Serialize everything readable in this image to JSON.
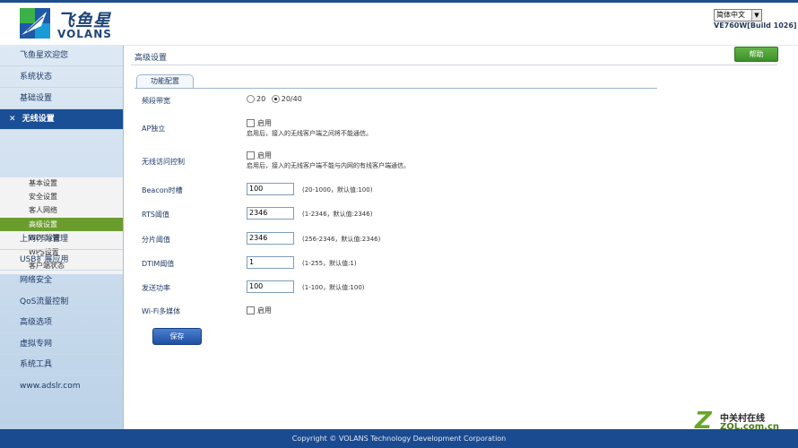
{
  "brand": {
    "name_cn": "飞鱼星",
    "name_en": "VOLANS"
  },
  "header": {
    "language": "简体中文",
    "build": "VE760W[Build 1026]"
  },
  "sidebar": {
    "items": [
      {
        "label": "飞鱼星欢迎您"
      },
      {
        "label": "系统状态"
      },
      {
        "label": "基础设置"
      },
      {
        "label": "无线设置"
      },
      {
        "label": "上网行为管理"
      },
      {
        "label": "USB扩展应用"
      },
      {
        "label": "网络安全"
      },
      {
        "label": "QoS流量控制"
      },
      {
        "label": "高级选项"
      },
      {
        "label": "虚拟专网"
      },
      {
        "label": "系统工具"
      },
      {
        "label": "www.adslr.com"
      }
    ],
    "submenu": [
      {
        "label": "基本设置"
      },
      {
        "label": "安全设置"
      },
      {
        "label": "客人网络"
      },
      {
        "label": "高级设置"
      },
      {
        "label": "WDS设置"
      },
      {
        "label": "WPS设置"
      },
      {
        "label": "客户端状态"
      }
    ],
    "expanded_marker": "✕"
  },
  "main": {
    "help": "帮助",
    "title": "高级设置",
    "tab": "功能配置",
    "bandwidth": {
      "label": "频段带宽",
      "options": [
        "20",
        "20/40"
      ],
      "selected": "20/40"
    },
    "ap_isolation": {
      "label": "AP独立",
      "checkbox": "启用",
      "note": "启用后，接入的无线客户端之间将不能通信。"
    },
    "wireless_access": {
      "label": "无线访问控制",
      "checkbox": "启用",
      "note": "启用后，接入的无线客户端不能与内网的有线客户端通信。"
    },
    "beacon": {
      "label": "Beacon时槽",
      "value": "100",
      "range": "(20-1000，默认值:100)"
    },
    "rts": {
      "label": "RTS阈值",
      "value": "2346",
      "range": "(1-2346，默认值:2346)"
    },
    "frag": {
      "label": "分片阈值",
      "value": "2346",
      "range": "(256-2346，默认值:2346)"
    },
    "dtim": {
      "label": "DTIM阈值",
      "value": "1",
      "range": "(1-255，默认值:1)"
    },
    "power": {
      "label": "发送功率",
      "value": "100",
      "range": "(1-100，默认值:100)"
    },
    "wmm": {
      "label": "Wi-Fi多媒体",
      "checkbox": "启用"
    },
    "save": "保存"
  },
  "footer": {
    "copyright": "Copyright © VOLANS Technology Development Corporation"
  },
  "watermark": {
    "cn": "中关村在线",
    "en": "ZOL.com.cn",
    "mark": "Z"
  },
  "colors": {
    "nav_active": "#1a4f95",
    "sub_active": "#6a9d2e",
    "footer": "#1a4a8f",
    "help": "#4aa236"
  }
}
